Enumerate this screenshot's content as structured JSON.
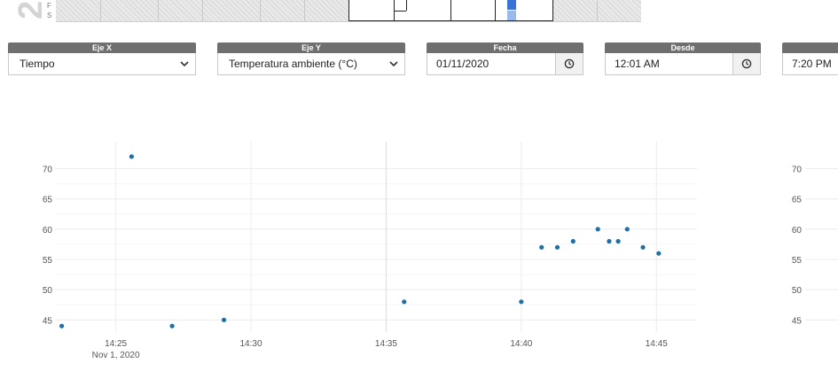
{
  "calendar_strip": {
    "big_number": "2",
    "row_letters": [
      "F",
      "S"
    ]
  },
  "controls": {
    "eje_x": {
      "label": "Eje X",
      "value": "Tiempo"
    },
    "eje_y": {
      "label": "Eje Y",
      "value": "Temperatura ambiente (°C)"
    },
    "fecha": {
      "label": "Fecha",
      "value": "01/11/2020"
    },
    "desde": {
      "label": "Desde",
      "value": "12:01 AM"
    },
    "hasta": {
      "value": "7:20 PM"
    }
  },
  "colors": {
    "accent": "#3a73d8",
    "point": "#1f6ea5",
    "label_bg": "#6f6f6f"
  },
  "chart_data": {
    "type": "scatter",
    "title": "",
    "xlabel": "",
    "ylabel": "",
    "x_ticks": [
      "14:25",
      "14:30",
      "14:35",
      "14:40",
      "14:45"
    ],
    "x_sub_label": "Nov 1, 2020",
    "y_ticks": [
      45,
      50,
      55,
      60,
      65,
      70
    ],
    "second_panel_y_ticks": [
      45,
      50,
      55,
      60,
      65,
      70
    ],
    "xlim": [
      "14:22:45",
      "14:46:30"
    ],
    "ylim": [
      43,
      73
    ],
    "grid": true,
    "series": [
      {
        "points": [
          {
            "x": "14:23:00",
            "y": 44
          },
          {
            "x": "14:25:35",
            "y": 72
          },
          {
            "x": "14:27:05",
            "y": 44
          },
          {
            "x": "14:29:00",
            "y": 45
          },
          {
            "x": "14:35:40",
            "y": 48
          },
          {
            "x": "14:40:00",
            "y": 48
          },
          {
            "x": "14:40:45",
            "y": 57
          },
          {
            "x": "14:41:20",
            "y": 57
          },
          {
            "x": "14:41:55",
            "y": 58
          },
          {
            "x": "14:42:50",
            "y": 60
          },
          {
            "x": "14:43:15",
            "y": 58
          },
          {
            "x": "14:43:35",
            "y": 58
          },
          {
            "x": "14:43:55",
            "y": 60
          },
          {
            "x": "14:44:30",
            "y": 57
          },
          {
            "x": "14:45:05",
            "y": 56
          }
        ]
      }
    ]
  }
}
